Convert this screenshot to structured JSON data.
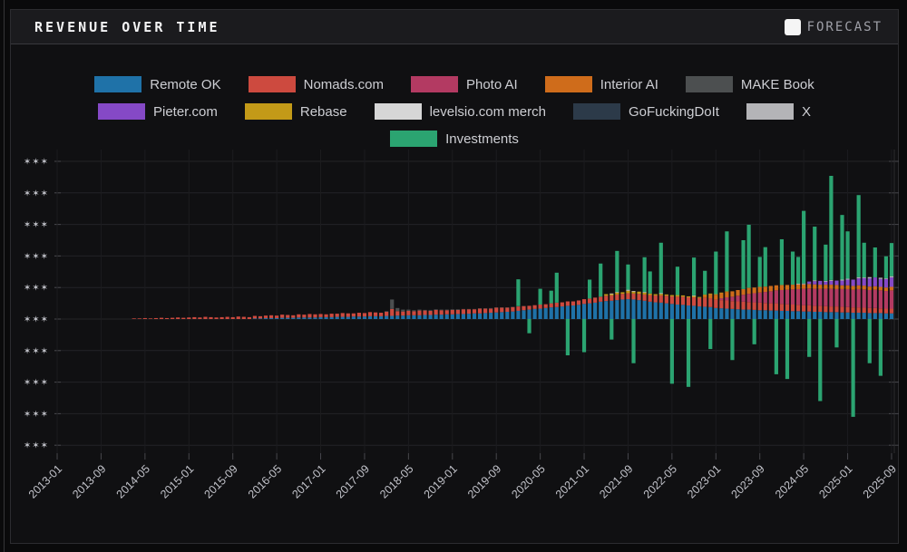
{
  "header": {
    "title": "REVENUE OVER TIME",
    "forecast_label": "FORECAST",
    "forecast_checked": false
  },
  "legend": {
    "rows": [
      [
        "ro",
        "no",
        "pa",
        "ia",
        "mb"
      ],
      [
        "pc",
        "rb",
        "me",
        "gf",
        "x"
      ],
      [
        "inv"
      ]
    ]
  },
  "chart_data": {
    "type": "bar",
    "stacked": true,
    "title": "REVENUE OVER TIME",
    "start_month": "2013-01",
    "end_month": "2025-09",
    "months": 153,
    "y_tick_label": "✶✶✶",
    "y_tick_count": 10,
    "zero_gridline_index": 5,
    "y_values_masked": true,
    "x_tick_every_months": 8,
    "x_tick_labels": [
      "2013-01",
      "2013-09",
      "2014-05",
      "2015-01",
      "2015-09",
      "2016-05",
      "2017-01",
      "2017-09",
      "2018-05",
      "2019-01",
      "2019-09",
      "2020-05",
      "2021-01",
      "2021-09",
      "2022-05",
      "2023-01",
      "2023-09",
      "2024-05",
      "2025-01",
      "2025-09"
    ],
    "grid": true,
    "legend_position": "top-center",
    "series": [
      {
        "key": "ro",
        "name": "Remote OK",
        "color": "#1f72a8"
      },
      {
        "key": "no",
        "name": "Nomads.com",
        "color": "#cd4a3f"
      },
      {
        "key": "pa",
        "name": "Photo AI",
        "color": "#b33a62"
      },
      {
        "key": "ia",
        "name": "Interior AI",
        "color": "#cf6c1b"
      },
      {
        "key": "mb",
        "name": "MAKE Book",
        "color": "#4c4f50"
      },
      {
        "key": "pc",
        "name": "Pieter.com",
        "color": "#8549c6"
      },
      {
        "key": "rb",
        "name": "Rebase",
        "color": "#c39a18"
      },
      {
        "key": "me",
        "name": "levelsio.com merch",
        "color": "#d6d6d6"
      },
      {
        "key": "gf",
        "name": "GoFuckingDoIt",
        "color": "#2c3a49"
      },
      {
        "key": "x",
        "name": "X",
        "color": "#b4b4b7"
      },
      {
        "key": "inv",
        "name": "Investments",
        "color": "#2ba471"
      }
    ],
    "bars": [
      {
        "i": 14,
        "no": 0.02
      },
      {
        "i": 15,
        "no": 0.02
      },
      {
        "i": 16,
        "no": 0.03
      },
      {
        "i": 17,
        "no": 0.02
      },
      {
        "i": 18,
        "no": 0.03
      },
      {
        "i": 19,
        "no": 0.04
      },
      {
        "i": 20,
        "no": 0.03
      },
      {
        "i": 21,
        "no": 0.04
      },
      {
        "i": 22,
        "no": 0.05
      },
      {
        "i": 23,
        "no": 0.04
      },
      {
        "i": 24,
        "no": 0.05
      },
      {
        "i": 25,
        "no": 0.06
      },
      {
        "i": 26,
        "no": 0.05
      },
      {
        "i": 27,
        "no": 0.07
      },
      {
        "i": 28,
        "no": 0.06
      },
      {
        "i": 29,
        "no": 0.05
      },
      {
        "i": 30,
        "no": 0.06
      },
      {
        "i": 31,
        "no": 0.07
      },
      {
        "i": 32,
        "no": 0.06
      },
      {
        "i": 33,
        "no": 0.08
      },
      {
        "i": 34,
        "no": 0.07
      },
      {
        "i": 35,
        "no": 0.06
      },
      {
        "i": 36,
        "ro": 0.02,
        "no": 0.08
      },
      {
        "i": 37,
        "ro": 0.02,
        "no": 0.07
      },
      {
        "i": 38,
        "ro": 0.03,
        "no": 0.08
      },
      {
        "i": 39,
        "ro": 0.03,
        "no": 0.09
      },
      {
        "i": 40,
        "ro": 0.03,
        "no": 0.08
      },
      {
        "i": 41,
        "ro": 0.04,
        "no": 0.1
      },
      {
        "i": 42,
        "ro": 0.04,
        "no": 0.09
      },
      {
        "i": 43,
        "ro": 0.04,
        "no": 0.08
      },
      {
        "i": 44,
        "ro": 0.05,
        "no": 0.1
      },
      {
        "i": 45,
        "ro": 0.05,
        "no": 0.09
      },
      {
        "i": 46,
        "ro": 0.05,
        "no": 0.11
      },
      {
        "i": 47,
        "ro": 0.05,
        "no": 0.1
      },
      {
        "i": 48,
        "ro": 0.06,
        "no": 0.1
      },
      {
        "i": 49,
        "ro": 0.06,
        "no": 0.09
      },
      {
        "i": 50,
        "ro": 0.06,
        "no": 0.11
      },
      {
        "i": 51,
        "ro": 0.07,
        "no": 0.1
      },
      {
        "i": 52,
        "ro": 0.07,
        "no": 0.12
      },
      {
        "i": 53,
        "ro": 0.07,
        "no": 0.11
      },
      {
        "i": 54,
        "ro": 0.08,
        "no": 0.1
      },
      {
        "i": 55,
        "ro": 0.08,
        "no": 0.12
      },
      {
        "i": 56,
        "ro": 0.08,
        "no": 0.11
      },
      {
        "i": 57,
        "ro": 0.09,
        "no": 0.13
      },
      {
        "i": 58,
        "ro": 0.09,
        "no": 0.12
      },
      {
        "i": 59,
        "ro": 0.09,
        "no": 0.11
      },
      {
        "i": 60,
        "ro": 0.1,
        "no": 0.13,
        "mb": 0.02
      },
      {
        "i": 61,
        "ro": 0.1,
        "no": 0.22,
        "mb": 0.3
      },
      {
        "i": 62,
        "ro": 0.11,
        "no": 0.14,
        "mb": 0.1
      },
      {
        "i": 63,
        "ro": 0.11,
        "no": 0.13,
        "mb": 0.06
      },
      {
        "i": 64,
        "ro": 0.12,
        "no": 0.14,
        "mb": 0.04
      },
      {
        "i": 65,
        "ro": 0.12,
        "no": 0.13,
        "mb": 0.03
      },
      {
        "i": 66,
        "ro": 0.12,
        "no": 0.15,
        "mb": 0.03
      },
      {
        "i": 67,
        "ro": 0.13,
        "no": 0.14,
        "mb": 0.02
      },
      {
        "i": 68,
        "ro": 0.13,
        "no": 0.13,
        "mb": 0.02,
        "gf": 0.01
      },
      {
        "i": 69,
        "ro": 0.14,
        "no": 0.15,
        "mb": 0.02
      },
      {
        "i": 70,
        "ro": 0.14,
        "no": 0.14,
        "mb": 0.02
      },
      {
        "i": 71,
        "ro": 0.15,
        "no": 0.13,
        "mb": 0.02
      },
      {
        "i": 72,
        "ro": 0.15,
        "no": 0.14,
        "mb": 0.02
      },
      {
        "i": 73,
        "ro": 0.16,
        "no": 0.13,
        "mb": 0.02
      },
      {
        "i": 74,
        "ro": 0.16,
        "no": 0.15,
        "mb": 0.01
      },
      {
        "i": 75,
        "ro": 0.17,
        "no": 0.14,
        "mb": 0.01
      },
      {
        "i": 76,
        "ro": 0.18,
        "no": 0.13,
        "mb": 0.01
      },
      {
        "i": 77,
        "ro": 0.18,
        "no": 0.15,
        "mb": 0.01
      },
      {
        "i": 78,
        "ro": 0.19,
        "no": 0.14,
        "mb": 0.01
      },
      {
        "i": 79,
        "ro": 0.2,
        "no": 0.13,
        "mb": 0.01,
        "gf": 0.01
      },
      {
        "i": 80,
        "ro": 0.21,
        "no": 0.15,
        "mb": 0.01
      },
      {
        "i": 81,
        "ro": 0.22,
        "no": 0.14,
        "mb": 0.01
      },
      {
        "i": 82,
        "ro": 0.23,
        "no": 0.13,
        "mb": 0.01
      },
      {
        "i": 83,
        "ro": 0.24,
        "no": 0.14,
        "mb": 0.01
      },
      {
        "i": 84,
        "ro": 0.26,
        "no": 0.14,
        "mb": 0.01,
        "inv": 0.85
      },
      {
        "i": 85,
        "ro": 0.28,
        "no": 0.13,
        "mb": 0.01
      },
      {
        "i": 86,
        "ro": 0.3,
        "no": 0.12,
        "inv": -0.45
      },
      {
        "i": 87,
        "ro": 0.32,
        "no": 0.12
      },
      {
        "i": 88,
        "ro": 0.33,
        "no": 0.13,
        "inv": 0.5
      },
      {
        "i": 89,
        "ro": 0.35,
        "no": 0.12
      },
      {
        "i": 90,
        "ro": 0.37,
        "no": 0.13,
        "inv": 0.4
      },
      {
        "i": 91,
        "ro": 0.38,
        "no": 0.14,
        "inv": 0.95
      },
      {
        "i": 92,
        "ro": 0.4,
        "no": 0.13
      },
      {
        "i": 93,
        "ro": 0.42,
        "no": 0.14,
        "inv": -1.15
      },
      {
        "i": 94,
        "ro": 0.43,
        "no": 0.13
      },
      {
        "i": 95,
        "ro": 0.45,
        "no": 0.14
      },
      {
        "i": 96,
        "ro": 0.48,
        "no": 0.15,
        "inv": -1.05
      },
      {
        "i": 97,
        "ro": 0.5,
        "no": 0.15,
        "inv": 0.6
      },
      {
        "i": 98,
        "ro": 0.52,
        "no": 0.16
      },
      {
        "i": 99,
        "ro": 0.55,
        "no": 0.16,
        "inv": 1.05
      },
      {
        "i": 100,
        "ro": 0.57,
        "no": 0.17,
        "rb": 0.05
      },
      {
        "i": 101,
        "ro": 0.58,
        "no": 0.17,
        "rb": 0.04,
        "me": 0.02,
        "inv": -0.65
      },
      {
        "i": 102,
        "ro": 0.6,
        "no": 0.18,
        "rb": 0.06,
        "me": 0.02,
        "inv": 1.3
      },
      {
        "i": 103,
        "ro": 0.62,
        "no": 0.18,
        "rb": 0.05
      },
      {
        "i": 104,
        "ro": 0.63,
        "no": 0.19,
        "rb": 0.08,
        "me": 0.03,
        "inv": 0.8
      },
      {
        "i": 105,
        "ro": 0.62,
        "no": 0.19,
        "rb": 0.06,
        "me": 0.02,
        "inv": -1.4
      },
      {
        "i": 106,
        "ro": 0.6,
        "no": 0.2,
        "rb": 0.07
      },
      {
        "i": 107,
        "ro": 0.58,
        "no": 0.2,
        "rb": 0.06,
        "me": 0.02,
        "inv": 1.1
      },
      {
        "i": 108,
        "ro": 0.55,
        "no": 0.21,
        "rb": 0.05,
        "inv": 0.7
      },
      {
        "i": 109,
        "ro": 0.53,
        "no": 0.22,
        "rb": 0.04
      },
      {
        "i": 110,
        "ro": 0.52,
        "no": 0.23,
        "rb": 0.05,
        "me": 0.02,
        "inv": 1.6
      },
      {
        "i": 111,
        "ro": 0.5,
        "no": 0.24,
        "rb": 0.04
      },
      {
        "i": 112,
        "ro": 0.48,
        "no": 0.24,
        "rb": 0.04,
        "inv": -2.05
      },
      {
        "i": 113,
        "ro": 0.46,
        "no": 0.25,
        "rb": 0.05,
        "inv": 0.9
      },
      {
        "i": 114,
        "ro": 0.45,
        "no": 0.26,
        "rb": 0.04
      },
      {
        "i": 115,
        "ro": 0.43,
        "no": 0.26,
        "rb": 0.03,
        "inv": -2.15
      },
      {
        "i": 116,
        "ro": 0.42,
        "no": 0.27,
        "rb": 0.04,
        "me": 0.02,
        "inv": 1.2
      },
      {
        "i": 117,
        "ro": 0.4,
        "no": 0.27,
        "rb": 0.03
      },
      {
        "i": 118,
        "ro": 0.39,
        "no": 0.28,
        "ia": 0.08,
        "rb": 0.03,
        "inv": 0.75
      },
      {
        "i": 119,
        "ro": 0.38,
        "no": 0.28,
        "ia": 0.12,
        "rb": 0.03,
        "inv": -0.95
      },
      {
        "i": 120,
        "ro": 0.35,
        "no": 0.27,
        "ia": 0.15,
        "rb": 0.02,
        "inv": 1.35
      },
      {
        "i": 121,
        "ro": 0.34,
        "no": 0.26,
        "pa": 0.06,
        "ia": 0.16,
        "rb": 0.02
      },
      {
        "i": 122,
        "ro": 0.33,
        "no": 0.26,
        "pa": 0.1,
        "ia": 0.17,
        "rb": 0.02,
        "inv": 1.9
      },
      {
        "i": 123,
        "ro": 0.32,
        "no": 0.25,
        "pa": 0.14,
        "ia": 0.17,
        "inv": -1.3
      },
      {
        "i": 124,
        "ro": 0.31,
        "no": 0.25,
        "pa": 0.18,
        "ia": 0.18
      },
      {
        "i": 125,
        "ro": 0.3,
        "no": 0.25,
        "pa": 0.22,
        "ia": 0.18,
        "inv": 1.55
      },
      {
        "i": 126,
        "ro": 0.3,
        "no": 0.24,
        "pa": 0.26,
        "ia": 0.19,
        "inv": 2.0
      },
      {
        "i": 127,
        "ro": 0.29,
        "no": 0.24,
        "pa": 0.29,
        "ia": 0.18,
        "inv": -0.8
      },
      {
        "i": 128,
        "ro": 0.28,
        "no": 0.24,
        "pa": 0.32,
        "ia": 0.18,
        "inv": 0.95
      },
      {
        "i": 129,
        "ro": 0.28,
        "no": 0.23,
        "pa": 0.35,
        "ia": 0.17,
        "inv": 1.25
      },
      {
        "i": 130,
        "ro": 0.27,
        "no": 0.23,
        "pa": 0.38,
        "ia": 0.17
      },
      {
        "i": 131,
        "ro": 0.27,
        "no": 0.23,
        "pa": 0.41,
        "ia": 0.16,
        "inv": -1.75
      },
      {
        "i": 132,
        "ro": 0.26,
        "no": 0.22,
        "pa": 0.44,
        "ia": 0.16,
        "inv": 1.45
      },
      {
        "i": 133,
        "ro": 0.26,
        "no": 0.21,
        "pa": 0.46,
        "ia": 0.15,
        "inv": -1.9
      },
      {
        "i": 134,
        "ro": 0.25,
        "no": 0.21,
        "pa": 0.48,
        "ia": 0.15,
        "inv": 1.05
      },
      {
        "i": 135,
        "ro": 0.25,
        "no": 0.2,
        "pa": 0.5,
        "ia": 0.15,
        "me": 0.02,
        "inv": 0.85
      },
      {
        "i": 136,
        "ro": 0.24,
        "no": 0.2,
        "pa": 0.52,
        "ia": 0.14,
        "x": 0.03,
        "inv": 2.3
      },
      {
        "i": 137,
        "ro": 0.24,
        "no": 0.2,
        "pa": 0.53,
        "ia": 0.14,
        "pc": 0.08,
        "inv": -1.2
      },
      {
        "i": 138,
        "ro": 0.23,
        "no": 0.19,
        "pa": 0.54,
        "ia": 0.14,
        "pc": 0.1,
        "x": 0.03,
        "inv": 1.7
      },
      {
        "i": 139,
        "ro": 0.23,
        "no": 0.19,
        "pa": 0.54,
        "ia": 0.13,
        "pc": 0.12,
        "inv": -2.6
      },
      {
        "i": 140,
        "ro": 0.22,
        "no": 0.19,
        "pa": 0.55,
        "ia": 0.13,
        "pc": 0.1,
        "me": 0.02,
        "inv": 1.15
      },
      {
        "i": 141,
        "ro": 0.22,
        "no": 0.18,
        "pa": 0.56,
        "ia": 0.13,
        "pc": 0.12,
        "x": 0.03,
        "inv": 3.3
      },
      {
        "i": 142,
        "ro": 0.22,
        "no": 0.18,
        "pa": 0.55,
        "ia": 0.13,
        "pc": 0.14,
        "inv": -0.9
      },
      {
        "i": 143,
        "ro": 0.21,
        "no": 0.18,
        "pa": 0.56,
        "ia": 0.12,
        "pc": 0.15,
        "x": 0.03,
        "inv": 2.05
      },
      {
        "i": 144,
        "ro": 0.21,
        "no": 0.17,
        "pa": 0.57,
        "ia": 0.12,
        "pc": 0.18,
        "x": 0.03,
        "inv": 1.5
      },
      {
        "i": 145,
        "ro": 0.2,
        "no": 0.17,
        "pa": 0.56,
        "ia": 0.12,
        "pc": 0.2,
        "inv": -3.1
      },
      {
        "i": 146,
        "ro": 0.2,
        "no": 0.17,
        "pa": 0.58,
        "ia": 0.12,
        "pc": 0.22,
        "x": 0.04,
        "inv": 2.6
      },
      {
        "i": 147,
        "ro": 0.2,
        "no": 0.16,
        "pa": 0.58,
        "ia": 0.12,
        "pc": 0.24,
        "me": 0.02,
        "inv": 1.1
      },
      {
        "i": 148,
        "ro": 0.19,
        "no": 0.16,
        "pa": 0.57,
        "ia": 0.11,
        "pc": 0.26,
        "x": 0.04,
        "inv": -1.4
      },
      {
        "i": 149,
        "ro": 0.19,
        "no": 0.16,
        "pa": 0.58,
        "ia": 0.11,
        "pc": 0.28,
        "inv": 0.95
      },
      {
        "i": 150,
        "ro": 0.19,
        "no": 0.15,
        "pa": 0.57,
        "ia": 0.11,
        "pc": 0.25,
        "x": 0.04,
        "inv": -1.8
      },
      {
        "i": 151,
        "ro": 0.18,
        "no": 0.15,
        "pa": 0.56,
        "ia": 0.11,
        "pc": 0.27,
        "me": 0.02,
        "inv": 0.7
      },
      {
        "i": 152,
        "ro": 0.18,
        "no": 0.15,
        "pa": 0.58,
        "ia": 0.11,
        "pc": 0.3,
        "x": 0.04,
        "inv": 1.05
      }
    ]
  }
}
